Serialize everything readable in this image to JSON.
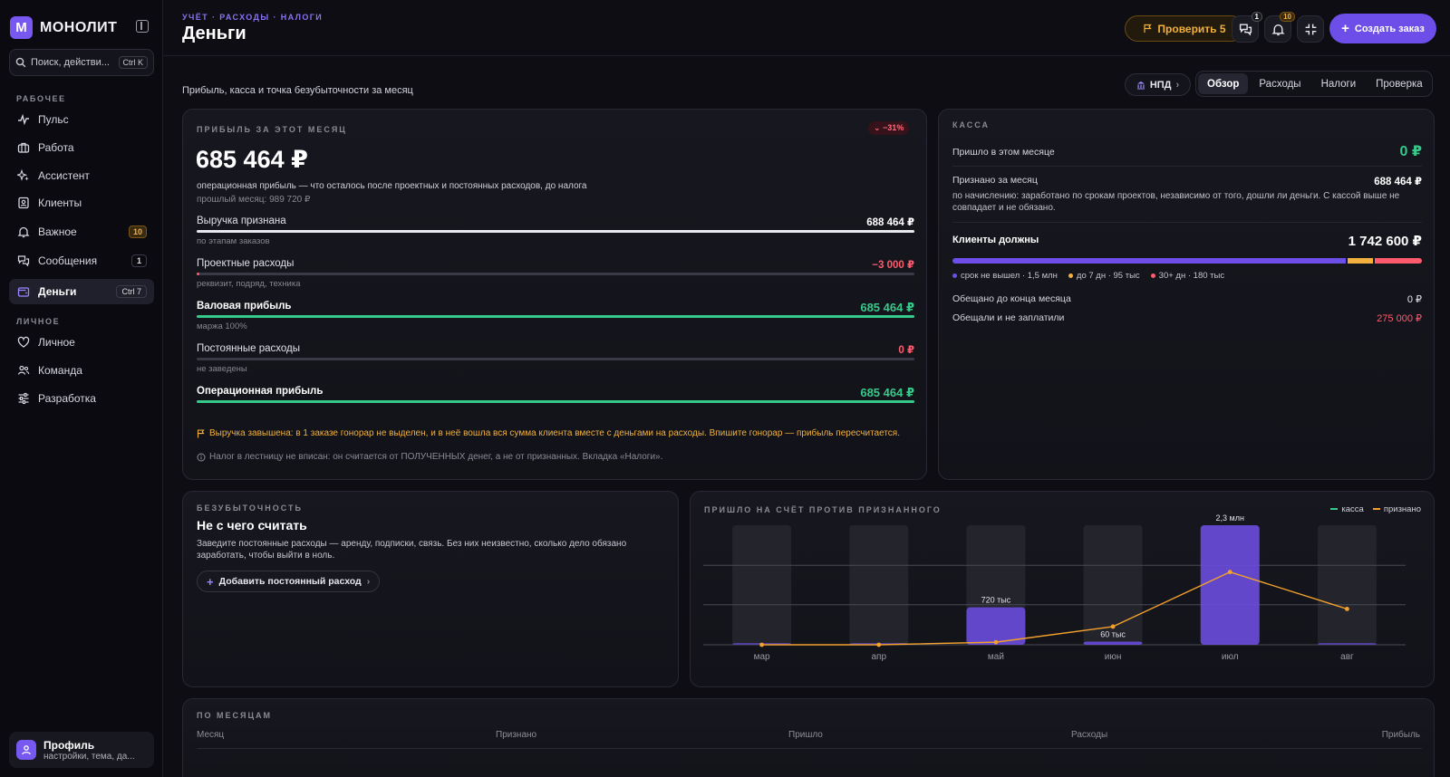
{
  "sidebar": {
    "logo_letter": "M",
    "app_name": "МОНОЛИТ",
    "search_placeholder": "Поиск, действи...",
    "search_kbd": "Ctrl K",
    "section_work": "РАБОЧЕЕ",
    "section_personal": "ЛИЧНОЕ",
    "items": [
      {
        "label": "Пульс",
        "icon": "pulse-icon"
      },
      {
        "label": "Работа",
        "icon": "briefcase-icon"
      },
      {
        "label": "Ассистент",
        "icon": "sparkles-icon"
      },
      {
        "label": "Клиенты",
        "icon": "contacts-icon"
      },
      {
        "label": "Важное",
        "icon": "bell-icon",
        "badge": "10"
      },
      {
        "label": "Сообщения",
        "icon": "chat-icon",
        "badge": "1"
      },
      {
        "label": "Деньги",
        "icon": "wallet-icon",
        "kbd": "Ctrl 7",
        "active": true
      },
      {
        "label": "Личное",
        "icon": "heart-icon"
      },
      {
        "label": "Команда",
        "icon": "team-icon"
      },
      {
        "label": "Разработка",
        "icon": "sliders-icon"
      }
    ],
    "profile": {
      "name": "Профиль",
      "sub": "настройки, тема, да..."
    }
  },
  "header": {
    "breadcrumbs": "УЧЁТ · РАСХОДЫ · НАЛОГИ",
    "title": "Деньги",
    "check_label": "Проверить 5",
    "messages_count": "1",
    "notifications_count": "10",
    "create_label": "Создать заказ"
  },
  "subheader": {
    "subtitle": "Прибыль, касса и точка безубыточности за месяц",
    "regime": "НПД",
    "tabs": [
      "Обзор",
      "Расходы",
      "Налоги",
      "Проверка"
    ],
    "active_tab": "Обзор"
  },
  "profit": {
    "label": "ПРИБЫЛЬ ЗА ЭТОТ МЕСЯЦ",
    "change": "−31%",
    "amount": "685 464 ₽",
    "description": "операционная прибыль — что осталось после проектных и постоянных расходов, до налога",
    "previous": "прошлый месяц: 989 720 ₽",
    "rows": [
      {
        "label": "Выручка признана",
        "value": "688 464 ₽",
        "sub": "по этапам заказов",
        "fill": 1.0,
        "color": "#e8e8ee",
        "value_color": "#ffffff"
      },
      {
        "label": "Проектные расходы",
        "value": "−3 000 ₽",
        "sub": "реквизит, подряд, техника",
        "fill": 0.004,
        "color": "#ff5b6e",
        "value_color": "#ff5b6e"
      },
      {
        "label": "Валовая прибыль",
        "value": "685 464 ₽",
        "sub": "маржа 100%",
        "fill": 1.0,
        "color": "#35c98a",
        "value_color": "#35c98a",
        "bold": true
      },
      {
        "label": "Постоянные расходы",
        "value": "0 ₽",
        "sub": "не заведены",
        "fill": 0,
        "color": "#ff5b6e",
        "value_color": "#ff5b6e"
      },
      {
        "label": "Операционная прибыль",
        "value": "685 464 ₽",
        "sub": "",
        "fill": 1.0,
        "color": "#35c98a",
        "value_color": "#35c98a",
        "bold": true
      }
    ],
    "warning": "Выручка завышена: в 1 заказе гонорар не выделен, и в неё вошла вся сумма клиента вместе с деньгами на расходы. Впишите гонорар — прибыль пересчитается.",
    "info": "Налог в лестницу не вписан: он считается от ПОЛУЧЕННЫХ денег, а не от признанных. Вкладка «Налоги»."
  },
  "kassa": {
    "label": "КАССА",
    "received_label": "Пришло в этом месяце",
    "received_value": "0 ₽",
    "recognized_label": "Признано за месяц",
    "recognized_value": "688 464 ₽",
    "recognized_desc": "по начислению: заработано по срокам проектов, независимо от того, дошли ли деньги. С кассой выше не совпадает и не обязано.",
    "clients_owe_label": "Клиенты должны",
    "clients_owe_value": "1 742 600 ₽",
    "debt_segments": [
      {
        "label": "срок не вышел · 1,5 млн",
        "value": 1.5,
        "color": "#6d4ee8"
      },
      {
        "label": "до 7 дн · 95 тыс",
        "value": 0.095,
        "color": "#f1b13c"
      },
      {
        "label": "30+ дн · 180 тыс",
        "value": 0.18,
        "color": "#ff5b6e"
      }
    ],
    "promised_label": "Обещано до конца месяца",
    "promised_value": "0 ₽",
    "unpaid_label": "Обещали и не заплатили",
    "unpaid_value": "275 000 ₽"
  },
  "breakeven": {
    "label": "БЕЗУБЫТОЧНОСТЬ",
    "title": "Не с чего считать",
    "description": "Заведите постоянные расходы — аренду, подписки, связь. Без них неизвестно, сколько дело обязано заработать, чтобы выйти в ноль.",
    "button": "Добавить постоянный расход"
  },
  "chart_data": {
    "type": "bar",
    "title": "ПРИШЛО НА СЧЁТ ПРОТИВ ПРИЗНАННОГО",
    "categories": [
      "мар",
      "апр",
      "май",
      "июн",
      "июл",
      "авг"
    ],
    "ylim": [
      0,
      2.3
    ],
    "series": [
      {
        "name": "касса",
        "type": "bar",
        "values": [
          0.01,
          0.01,
          0.72,
          0.06,
          2.3,
          0.01
        ],
        "color": "#6d4ee8"
      },
      {
        "name": "признано",
        "type": "line",
        "values": [
          0.0,
          0.0,
          0.05,
          0.35,
          1.4,
          0.69
        ],
        "color": "#f1a12c"
      }
    ],
    "data_labels": [
      {
        "index": 2,
        "text": "720 тыс"
      },
      {
        "index": 3,
        "text": "60 тыс"
      },
      {
        "index": 4,
        "text": "2,3 млн"
      }
    ],
    "gridlines": [
      0.77,
      1.53
    ],
    "grid": true,
    "legend": "top-right"
  },
  "months": {
    "label": "ПО МЕСЯЦАМ",
    "columns": [
      "Месяц",
      "Признано",
      "Пришло",
      "Расходы",
      "Прибыль"
    ]
  }
}
